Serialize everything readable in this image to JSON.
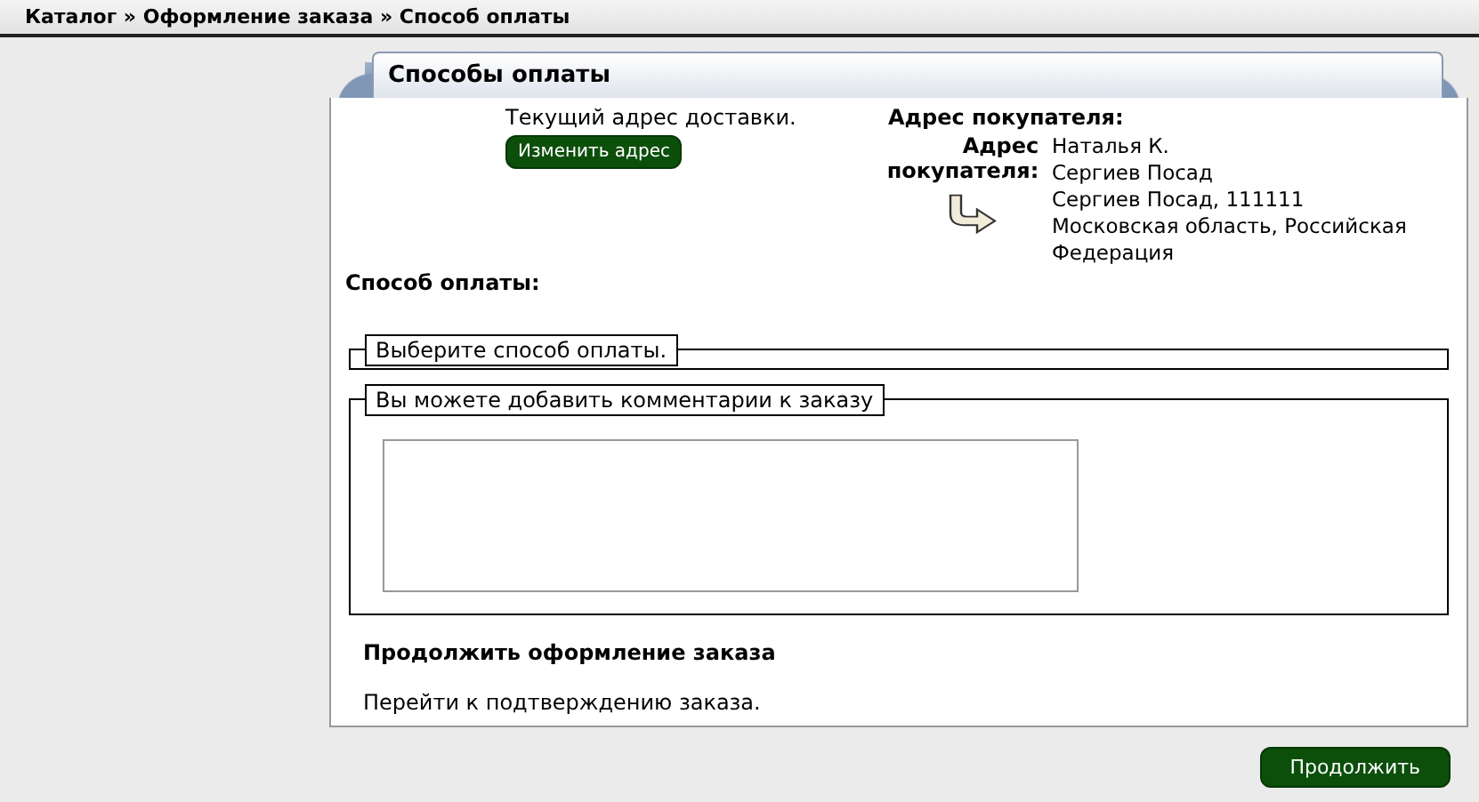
{
  "breadcrumb": "Каталог » Оформление заказа » Способ оплаты",
  "panel": {
    "title": "Способы оплаты",
    "delivery": {
      "text": "Текущий адрес доставки.",
      "button": "Изменить адрес"
    },
    "address": {
      "heading": "Адрес покупателя:",
      "label": "Адрес покупателя:",
      "lines": [
        "Наталья К.",
        "Сергиев Посад",
        "Сергиев Посад, 111111",
        "Московская область, Российская Федерация"
      ]
    },
    "payment_heading": "Способ оплаты:",
    "payment_fieldset": {
      "legend": "Выберите способ оплаты."
    },
    "comments_fieldset": {
      "legend": "Вы можете добавить комментарии к заказу"
    },
    "continue": {
      "heading": "Продолжить оформление заказа",
      "text": "Перейти к подтверждению заказа."
    }
  },
  "continue_button": "Продолжить"
}
